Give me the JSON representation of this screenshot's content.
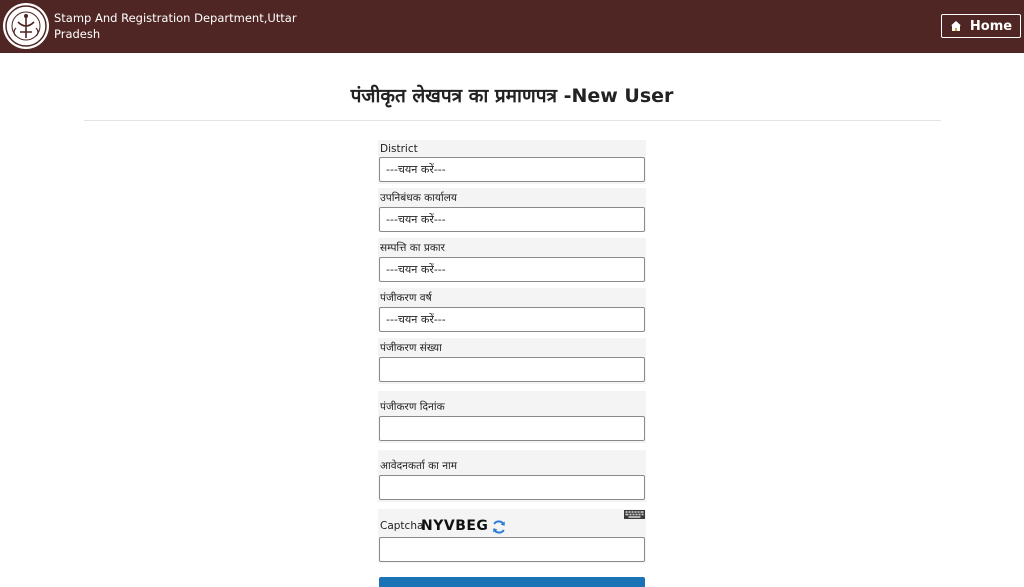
{
  "header": {
    "brand_line1": "Stamp And Registration Department,Uttar",
    "brand_line2": "Pradesh",
    "home_label": "Home",
    "background_color": "#4f2623"
  },
  "page": {
    "title": "पंजीकृत लेखपत्र का प्रमाणपत्र -New User"
  },
  "form": {
    "district": {
      "label": "District",
      "value": "---चयन करें---"
    },
    "sub_registrar_office": {
      "label": "उपनिबंधक कार्यालय",
      "value": "---चयन करें---"
    },
    "property_type": {
      "label": "सम्पत्ति का प्रकार",
      "value": "---चयन करें---"
    },
    "registration_year": {
      "label": "पंजीकरण वर्ष",
      "value": "---चयन करें---"
    },
    "registration_number": {
      "label": "पंजीकरण संख्या",
      "value": ""
    },
    "registration_date": {
      "label": "पंजीकरण दिनांक",
      "value": ""
    },
    "applicant_name": {
      "label": "आवेदनकर्ता का नाम",
      "value": ""
    },
    "captcha": {
      "label": "Captcha",
      "code": "NYVBEG",
      "value": ""
    },
    "submit_color": "#1a73b5"
  }
}
